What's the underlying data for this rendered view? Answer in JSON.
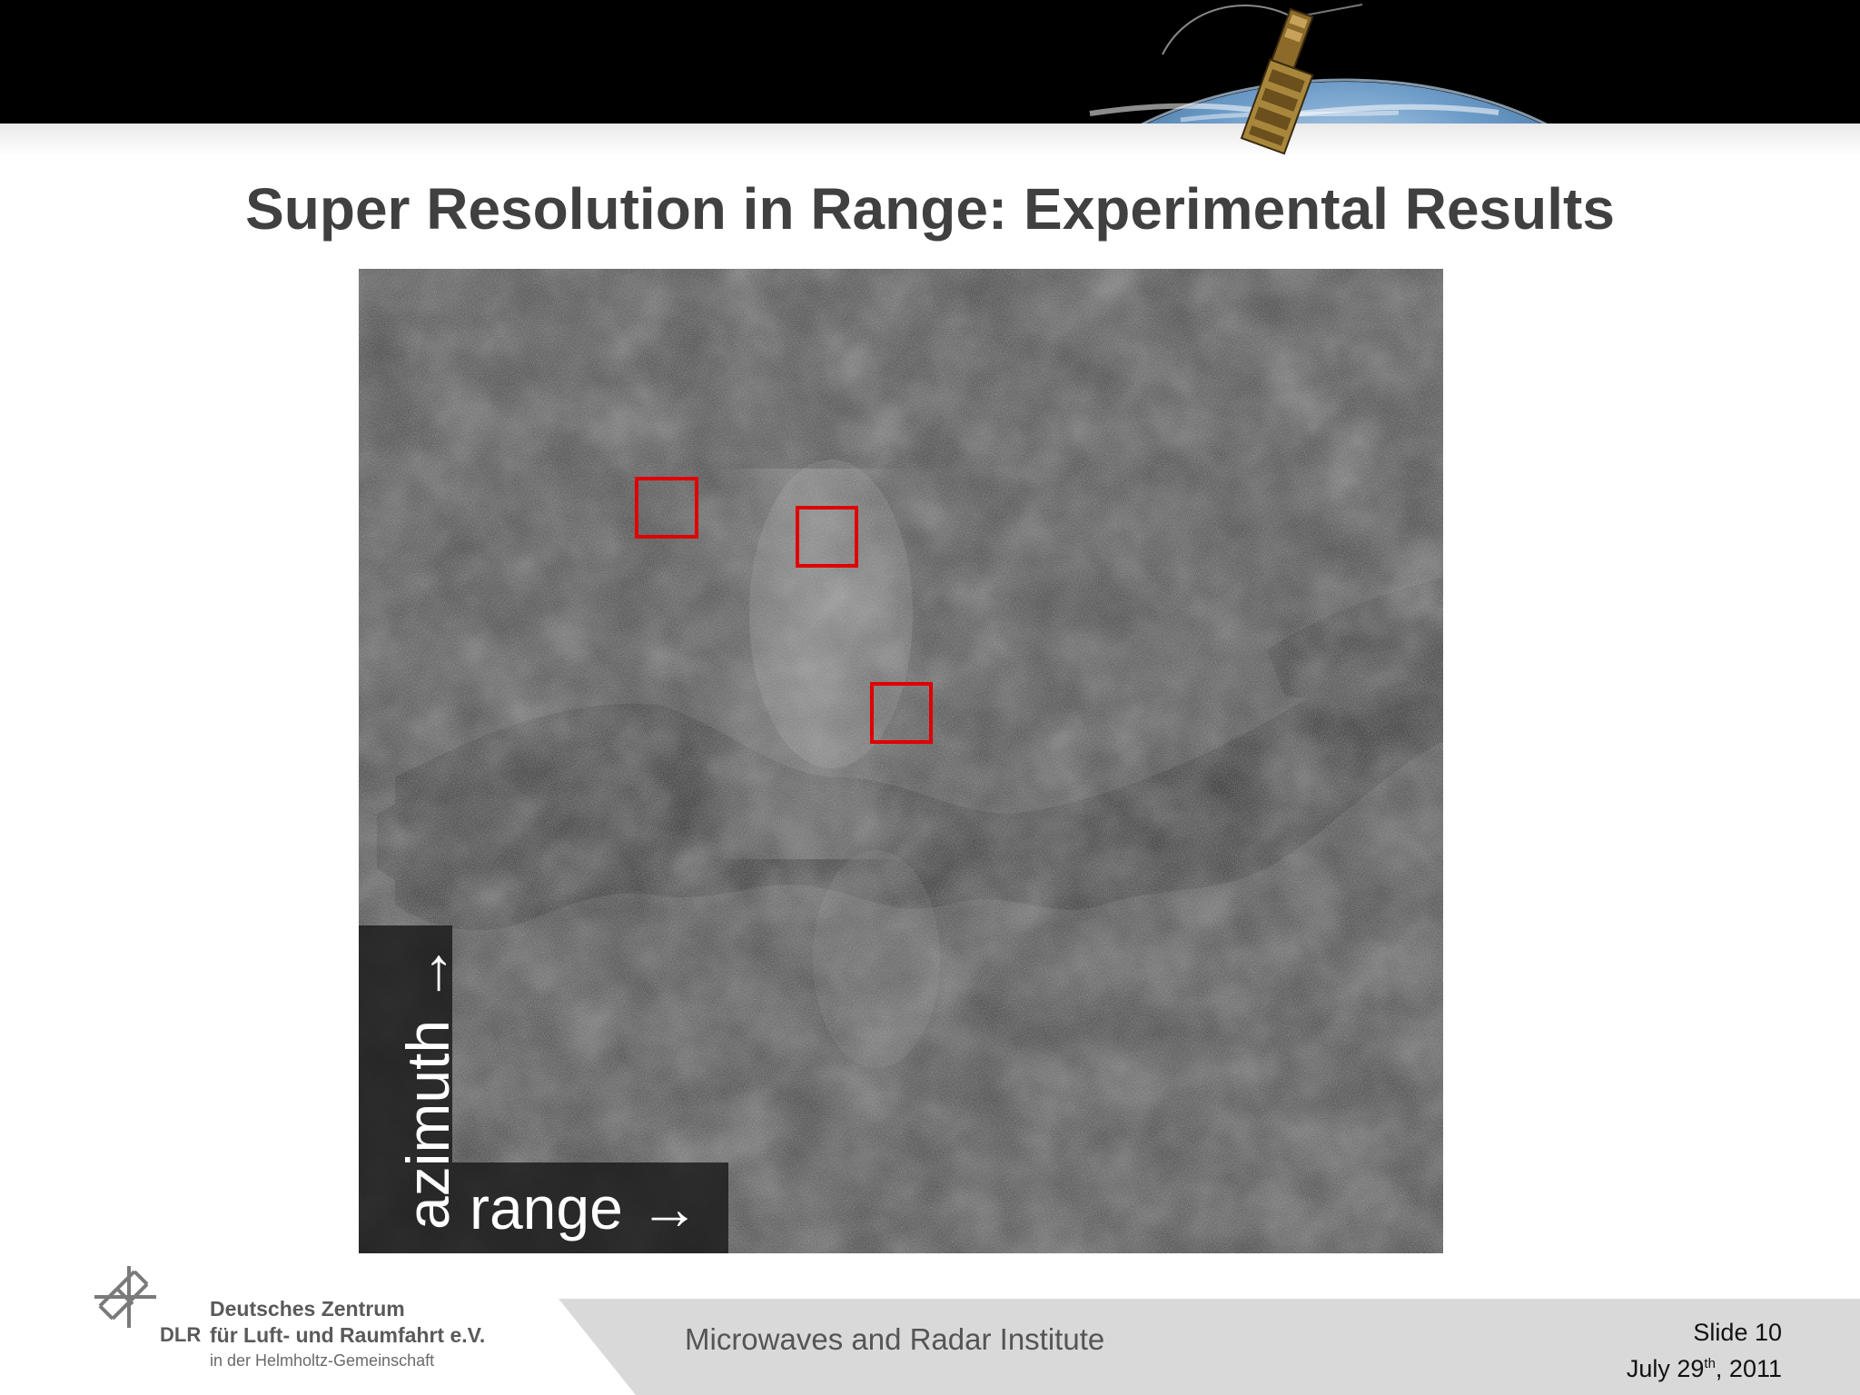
{
  "slide": {
    "title": "Super Resolution in Range: Experimental Results"
  },
  "image": {
    "azimuth_label": "azimuth →",
    "range_label": "range →",
    "roi_color": "#e00000"
  },
  "footer": {
    "org_name_line1": "Deutsches Zentrum",
    "org_name_line2": "für Luft- und Raumfahrt e.V.",
    "org_name_line3": "in der Helmholtz-Gemeinschaft",
    "org_abbr": "DLR",
    "institute": "Microwaves and Radar Institute",
    "slide_number": "Slide 10",
    "date_month_day": "July 29",
    "date_suffix": "th",
    "date_year": ", 2011"
  },
  "colors": {
    "title": "#404040",
    "footer_band": "#d9d9d9",
    "header": "#000000"
  }
}
